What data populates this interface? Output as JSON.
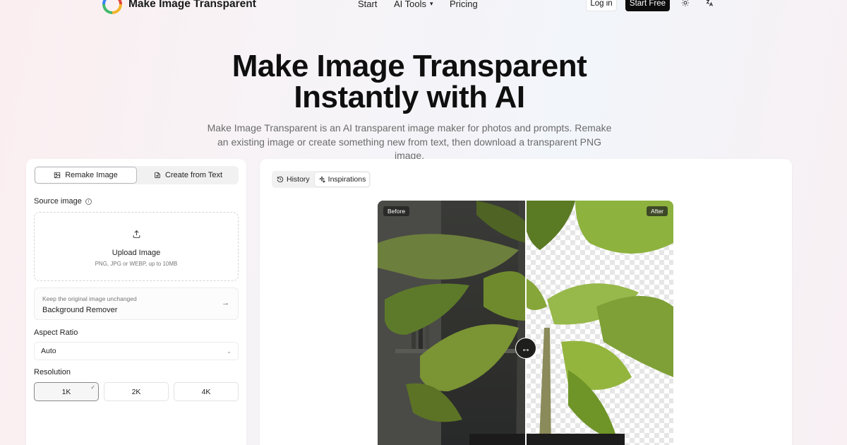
{
  "nav": {
    "brand": "Make Image Transparent",
    "links": [
      "Start",
      "AI Tools",
      "Pricing"
    ],
    "login": "Log in",
    "start_free": "Start Free"
  },
  "hero": {
    "title_line1": "Make Image Transparent",
    "title_line2": "Instantly with AI",
    "subtitle": "Make Image Transparent is an AI transparent image maker for photos and prompts. Remake an existing image or create something new from text, then download a transparent PNG image."
  },
  "left": {
    "tabs": [
      "Remake Image",
      "Create from Text"
    ],
    "source_label": "Source image",
    "upload_title": "Upload Image",
    "upload_hint": "PNG, JPG or WEBP, up to 10MB",
    "bg_hint": "Keep the original image unchanged",
    "bg_title": "Background Remover",
    "aspect_label": "Aspect Ratio",
    "aspect_value": "Auto",
    "resolution_label": "Resolution",
    "resolutions": [
      "1K",
      "2K",
      "4K"
    ],
    "selected_resolution": "1K"
  },
  "right": {
    "tabs": [
      "History",
      "Inspirations"
    ],
    "before_label": "Before",
    "after_label": "After"
  },
  "colors": {
    "accent_dark": "#0d0d0d",
    "background_pink": "#fbeef0"
  }
}
